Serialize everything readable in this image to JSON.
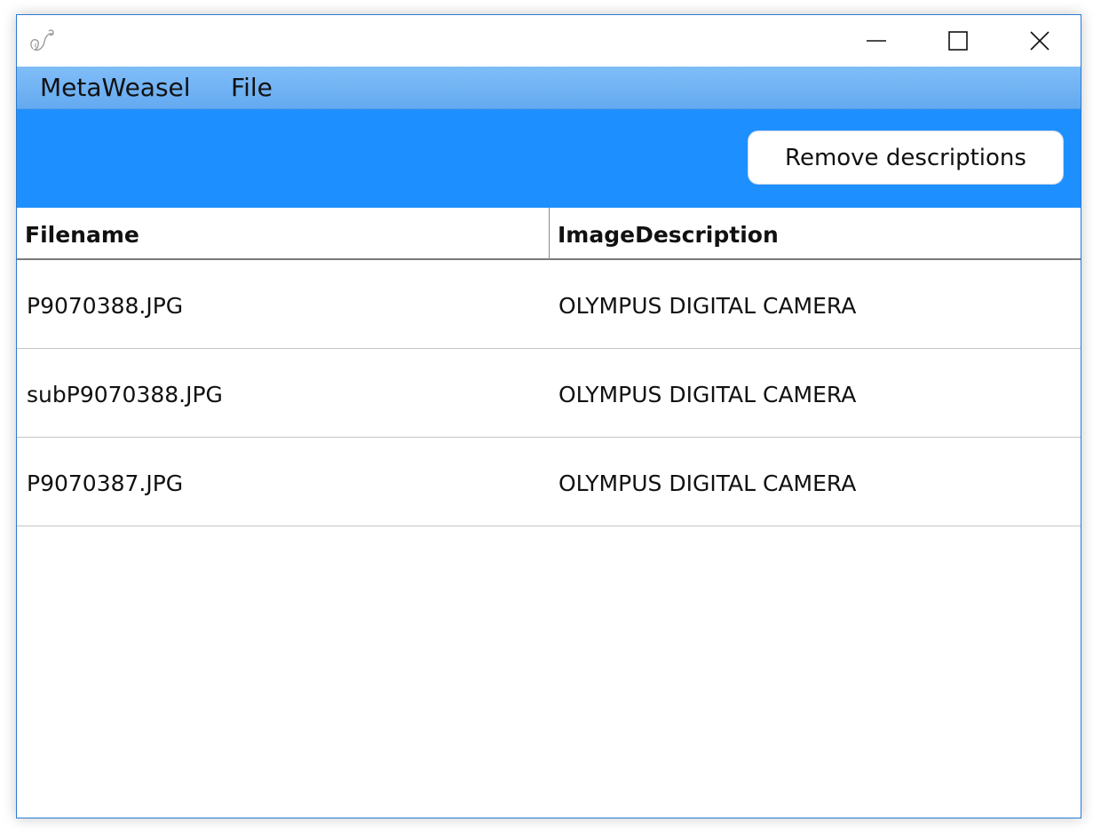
{
  "window": {
    "controls": {
      "minimize_icon": "minimize-icon",
      "maximize_icon": "maximize-icon",
      "close_icon": "close-icon"
    },
    "app_icon": "weasel-logo-icon"
  },
  "menu": {
    "items": [
      {
        "label": "MetaWeasel"
      },
      {
        "label": "File"
      }
    ]
  },
  "toolbar": {
    "remove_label": "Remove descriptions"
  },
  "table": {
    "columns": [
      "Filename",
      "ImageDescription"
    ],
    "rows": [
      {
        "filename": "P9070388.JPG",
        "description": "OLYMPUS DIGITAL CAMERA"
      },
      {
        "filename": "subP9070388.JPG",
        "description": "OLYMPUS DIGITAL CAMERA"
      },
      {
        "filename": "P9070387.JPG",
        "description": "OLYMPUS DIGITAL CAMERA"
      }
    ]
  },
  "colors": {
    "menubar": "#6fb3f5",
    "toolbar": "#1e8fff",
    "window_border": "#2b7bd0"
  }
}
